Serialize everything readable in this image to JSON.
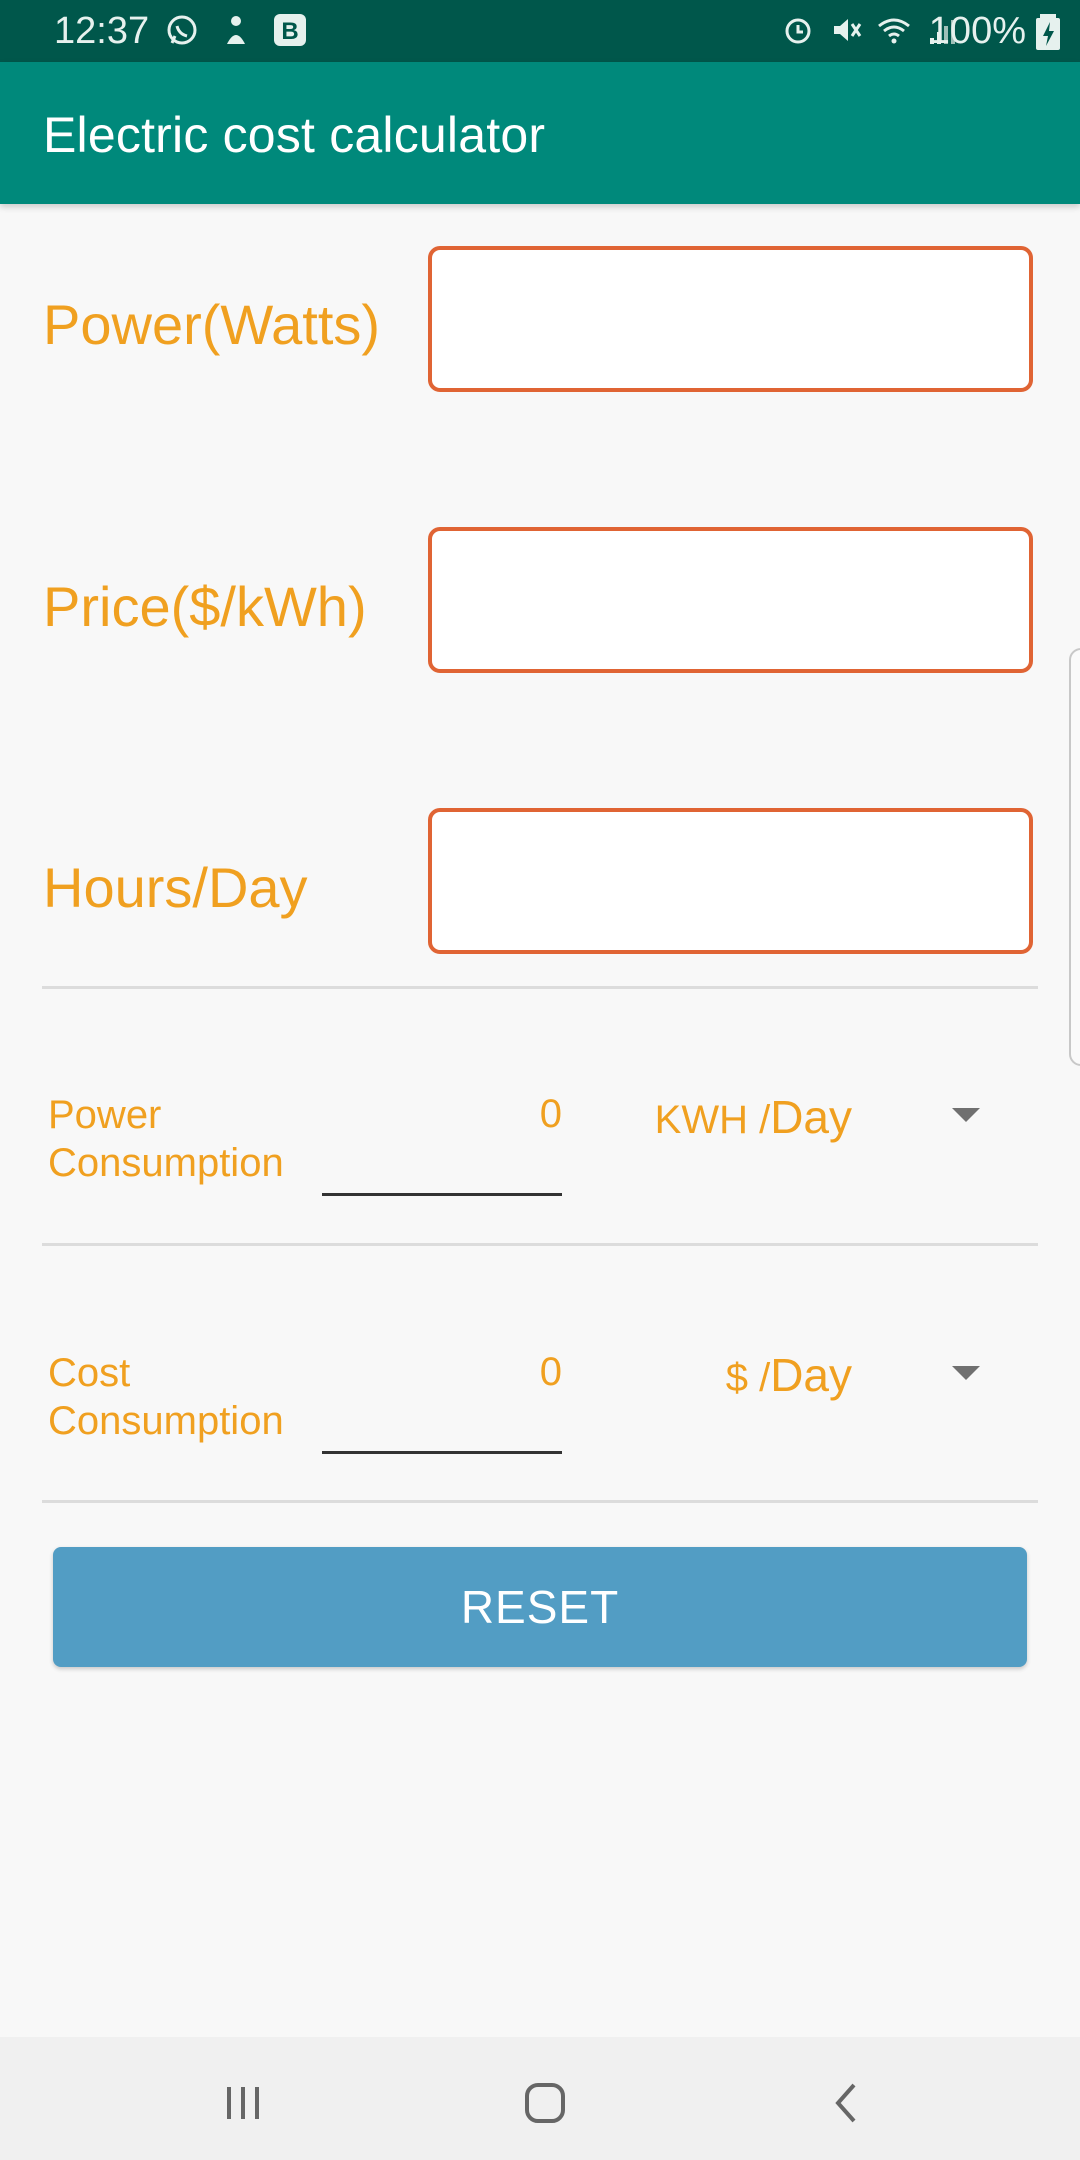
{
  "status_bar": {
    "time": "12:37",
    "left_icons": [
      "whatsapp-icon",
      "notification-person-icon",
      "b-app-icon"
    ],
    "right_icons": [
      "alarm-icon",
      "mute-icon",
      "wifi-icon",
      "signal-icon"
    ],
    "battery": "100%",
    "battery_icon": "battery-charging-icon"
  },
  "app_bar": {
    "title": "Electric cost calculator"
  },
  "form": {
    "power": {
      "label": "Power(Watts)",
      "value": "",
      "placeholder": ""
    },
    "price": {
      "label": "Price($/kWh)",
      "value": "",
      "placeholder": ""
    },
    "hours": {
      "label": "Hours/Day",
      "value": "",
      "placeholder": ""
    }
  },
  "results": {
    "power_consumption": {
      "label_line1": "Power",
      "label_line2": "Consumption",
      "value": "0",
      "unit_prefix": "KWH /",
      "unit_period": "Day"
    },
    "cost_consumption": {
      "label_line1": "Cost",
      "label_line2": "Consumption",
      "value": "0",
      "unit_prefix": "$ /",
      "unit_period": "Day"
    }
  },
  "actions": {
    "reset_label": "RESET"
  },
  "nav_bar": {
    "icons": [
      "recent-apps-icon",
      "home-icon",
      "back-icon"
    ]
  },
  "colors": {
    "status_bar": "#00574b",
    "app_bar": "#00897b",
    "label_orange": "#f0a020",
    "input_border": "#e06434",
    "reset_button": "#529dc4"
  }
}
